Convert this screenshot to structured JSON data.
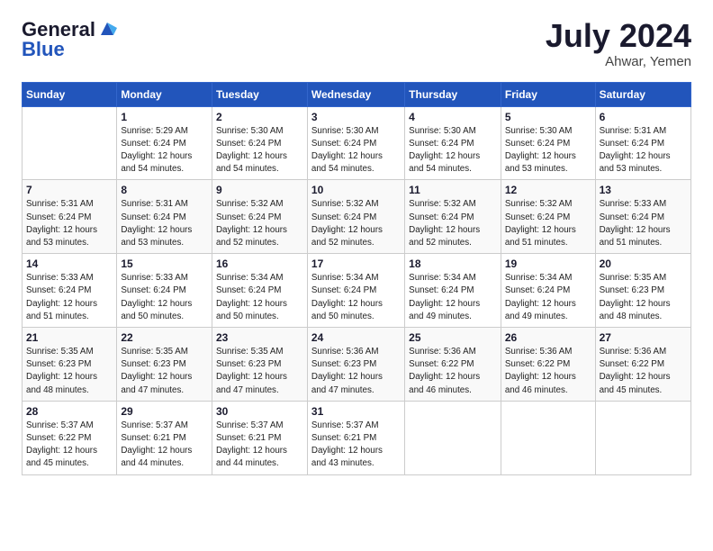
{
  "header": {
    "logo_line1": "General",
    "logo_line2": "Blue",
    "month": "July 2024",
    "location": "Ahwar, Yemen"
  },
  "columns": [
    "Sunday",
    "Monday",
    "Tuesday",
    "Wednesday",
    "Thursday",
    "Friday",
    "Saturday"
  ],
  "weeks": [
    [
      {
        "day": "",
        "info": ""
      },
      {
        "day": "1",
        "info": "Sunrise: 5:29 AM\nSunset: 6:24 PM\nDaylight: 12 hours\nand 54 minutes."
      },
      {
        "day": "2",
        "info": "Sunrise: 5:30 AM\nSunset: 6:24 PM\nDaylight: 12 hours\nand 54 minutes."
      },
      {
        "day": "3",
        "info": "Sunrise: 5:30 AM\nSunset: 6:24 PM\nDaylight: 12 hours\nand 54 minutes."
      },
      {
        "day": "4",
        "info": "Sunrise: 5:30 AM\nSunset: 6:24 PM\nDaylight: 12 hours\nand 54 minutes."
      },
      {
        "day": "5",
        "info": "Sunrise: 5:30 AM\nSunset: 6:24 PM\nDaylight: 12 hours\nand 53 minutes."
      },
      {
        "day": "6",
        "info": "Sunrise: 5:31 AM\nSunset: 6:24 PM\nDaylight: 12 hours\nand 53 minutes."
      }
    ],
    [
      {
        "day": "7",
        "info": "Sunrise: 5:31 AM\nSunset: 6:24 PM\nDaylight: 12 hours\nand 53 minutes."
      },
      {
        "day": "8",
        "info": "Sunrise: 5:31 AM\nSunset: 6:24 PM\nDaylight: 12 hours\nand 53 minutes."
      },
      {
        "day": "9",
        "info": "Sunrise: 5:32 AM\nSunset: 6:24 PM\nDaylight: 12 hours\nand 52 minutes."
      },
      {
        "day": "10",
        "info": "Sunrise: 5:32 AM\nSunset: 6:24 PM\nDaylight: 12 hours\nand 52 minutes."
      },
      {
        "day": "11",
        "info": "Sunrise: 5:32 AM\nSunset: 6:24 PM\nDaylight: 12 hours\nand 52 minutes."
      },
      {
        "day": "12",
        "info": "Sunrise: 5:32 AM\nSunset: 6:24 PM\nDaylight: 12 hours\nand 51 minutes."
      },
      {
        "day": "13",
        "info": "Sunrise: 5:33 AM\nSunset: 6:24 PM\nDaylight: 12 hours\nand 51 minutes."
      }
    ],
    [
      {
        "day": "14",
        "info": "Sunrise: 5:33 AM\nSunset: 6:24 PM\nDaylight: 12 hours\nand 51 minutes."
      },
      {
        "day": "15",
        "info": "Sunrise: 5:33 AM\nSunset: 6:24 PM\nDaylight: 12 hours\nand 50 minutes."
      },
      {
        "day": "16",
        "info": "Sunrise: 5:34 AM\nSunset: 6:24 PM\nDaylight: 12 hours\nand 50 minutes."
      },
      {
        "day": "17",
        "info": "Sunrise: 5:34 AM\nSunset: 6:24 PM\nDaylight: 12 hours\nand 50 minutes."
      },
      {
        "day": "18",
        "info": "Sunrise: 5:34 AM\nSunset: 6:24 PM\nDaylight: 12 hours\nand 49 minutes."
      },
      {
        "day": "19",
        "info": "Sunrise: 5:34 AM\nSunset: 6:24 PM\nDaylight: 12 hours\nand 49 minutes."
      },
      {
        "day": "20",
        "info": "Sunrise: 5:35 AM\nSunset: 6:23 PM\nDaylight: 12 hours\nand 48 minutes."
      }
    ],
    [
      {
        "day": "21",
        "info": "Sunrise: 5:35 AM\nSunset: 6:23 PM\nDaylight: 12 hours\nand 48 minutes."
      },
      {
        "day": "22",
        "info": "Sunrise: 5:35 AM\nSunset: 6:23 PM\nDaylight: 12 hours\nand 47 minutes."
      },
      {
        "day": "23",
        "info": "Sunrise: 5:35 AM\nSunset: 6:23 PM\nDaylight: 12 hours\nand 47 minutes."
      },
      {
        "day": "24",
        "info": "Sunrise: 5:36 AM\nSunset: 6:23 PM\nDaylight: 12 hours\nand 47 minutes."
      },
      {
        "day": "25",
        "info": "Sunrise: 5:36 AM\nSunset: 6:22 PM\nDaylight: 12 hours\nand 46 minutes."
      },
      {
        "day": "26",
        "info": "Sunrise: 5:36 AM\nSunset: 6:22 PM\nDaylight: 12 hours\nand 46 minutes."
      },
      {
        "day": "27",
        "info": "Sunrise: 5:36 AM\nSunset: 6:22 PM\nDaylight: 12 hours\nand 45 minutes."
      }
    ],
    [
      {
        "day": "28",
        "info": "Sunrise: 5:37 AM\nSunset: 6:22 PM\nDaylight: 12 hours\nand 45 minutes."
      },
      {
        "day": "29",
        "info": "Sunrise: 5:37 AM\nSunset: 6:21 PM\nDaylight: 12 hours\nand 44 minutes."
      },
      {
        "day": "30",
        "info": "Sunrise: 5:37 AM\nSunset: 6:21 PM\nDaylight: 12 hours\nand 44 minutes."
      },
      {
        "day": "31",
        "info": "Sunrise: 5:37 AM\nSunset: 6:21 PM\nDaylight: 12 hours\nand 43 minutes."
      },
      {
        "day": "",
        "info": ""
      },
      {
        "day": "",
        "info": ""
      },
      {
        "day": "",
        "info": ""
      }
    ]
  ]
}
